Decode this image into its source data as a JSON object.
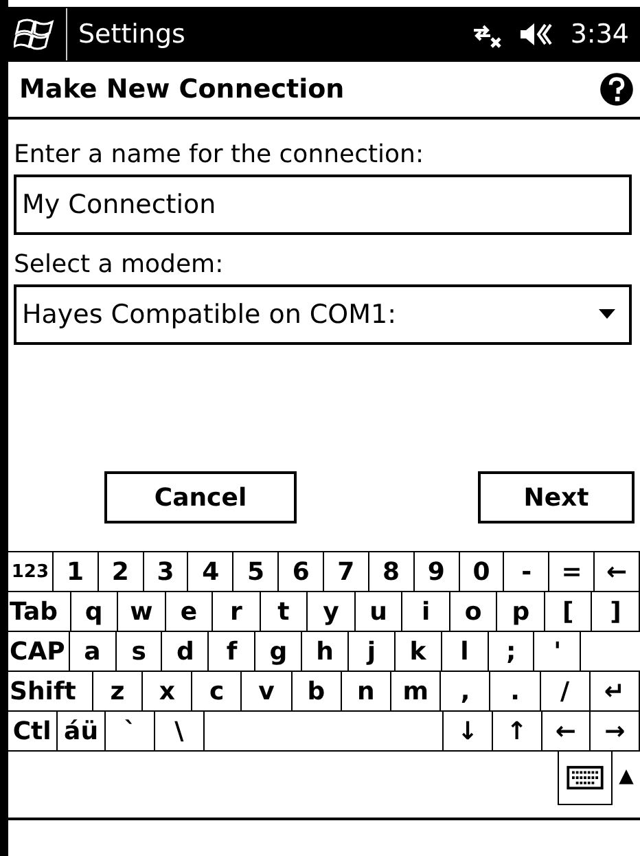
{
  "title_bar": {
    "title": "Settings",
    "time": "3:34"
  },
  "header": {
    "title": "Make New Connection"
  },
  "form": {
    "name_label": "Enter a name for the connection:",
    "name_value": "My Connection",
    "modem_label": "Select a modem:",
    "modem_value": "Hayes Compatible on COM1:"
  },
  "buttons": [
    "Cancel",
    "Next"
  ],
  "keyboard": {
    "key_rows": [
      {
        "keys": [
          {
            "label": "123",
            "kind": "small"
          },
          {
            "label": "1",
            "kind": "key"
          },
          {
            "label": "2",
            "kind": "key"
          },
          {
            "label": "3",
            "kind": "key"
          },
          {
            "label": "4",
            "kind": "key"
          },
          {
            "label": "5",
            "kind": "key"
          },
          {
            "label": "6",
            "kind": "key"
          },
          {
            "label": "7",
            "kind": "key"
          },
          {
            "label": "8",
            "kind": "key"
          },
          {
            "label": "9",
            "kind": "key"
          },
          {
            "label": "0",
            "kind": "key"
          },
          {
            "label": "-",
            "kind": "key"
          },
          {
            "label": "=",
            "kind": "key"
          },
          {
            "label": "←",
            "kind": "key"
          }
        ]
      },
      {
        "keys": [
          {
            "label": "Tab",
            "kind": "wide"
          },
          {
            "label": "q",
            "kind": "key"
          },
          {
            "label": "w",
            "kind": "key"
          },
          {
            "label": "e",
            "kind": "key"
          },
          {
            "label": "r",
            "kind": "key"
          },
          {
            "label": "t",
            "kind": "key"
          },
          {
            "label": "y",
            "kind": "key"
          },
          {
            "label": "u",
            "kind": "key"
          },
          {
            "label": "i",
            "kind": "key"
          },
          {
            "label": "o",
            "kind": "key"
          },
          {
            "label": "p",
            "kind": "key"
          },
          {
            "label": "[",
            "kind": "key"
          },
          {
            "label": "]",
            "kind": "key"
          }
        ]
      },
      {
        "keys": [
          {
            "label": "CAP",
            "kind": "wide"
          },
          {
            "label": "a",
            "kind": "key"
          },
          {
            "label": "s",
            "kind": "key"
          },
          {
            "label": "d",
            "kind": "key"
          },
          {
            "label": "f",
            "kind": "key"
          },
          {
            "label": "g",
            "kind": "key"
          },
          {
            "label": "h",
            "kind": "key"
          },
          {
            "label": "j",
            "kind": "key"
          },
          {
            "label": "k",
            "kind": "key"
          },
          {
            "label": "l",
            "kind": "key"
          },
          {
            "label": ";",
            "kind": "key"
          },
          {
            "label": "'",
            "kind": "key"
          },
          {
            "kind": "blank"
          }
        ]
      },
      {
        "keys": [
          {
            "label": "Shift",
            "kind": "wider"
          },
          {
            "label": "z",
            "kind": "key"
          },
          {
            "label": "x",
            "kind": "key"
          },
          {
            "label": "c",
            "kind": "key"
          },
          {
            "label": "v",
            "kind": "key"
          },
          {
            "label": "b",
            "kind": "key"
          },
          {
            "label": "n",
            "kind": "key"
          },
          {
            "label": "m",
            "kind": "key"
          },
          {
            "label": ",",
            "kind": "key"
          },
          {
            "label": ".",
            "kind": "key"
          },
          {
            "label": "/",
            "kind": "key"
          },
          {
            "label": "↵",
            "kind": "key"
          }
        ]
      },
      {
        "keys": [
          {
            "label": "Ctl",
            "kind": "key"
          },
          {
            "label": "áü",
            "kind": "key"
          },
          {
            "label": "`",
            "kind": "key"
          },
          {
            "label": "\\",
            "kind": "key"
          },
          {
            "kind": "space"
          },
          {
            "label": "↓",
            "kind": "key"
          },
          {
            "label": "↑",
            "kind": "key"
          },
          {
            "label": "←",
            "kind": "key"
          },
          {
            "label": "→",
            "kind": "key"
          }
        ]
      }
    ]
  },
  "input_panel": {
    "arrow": "▲"
  }
}
